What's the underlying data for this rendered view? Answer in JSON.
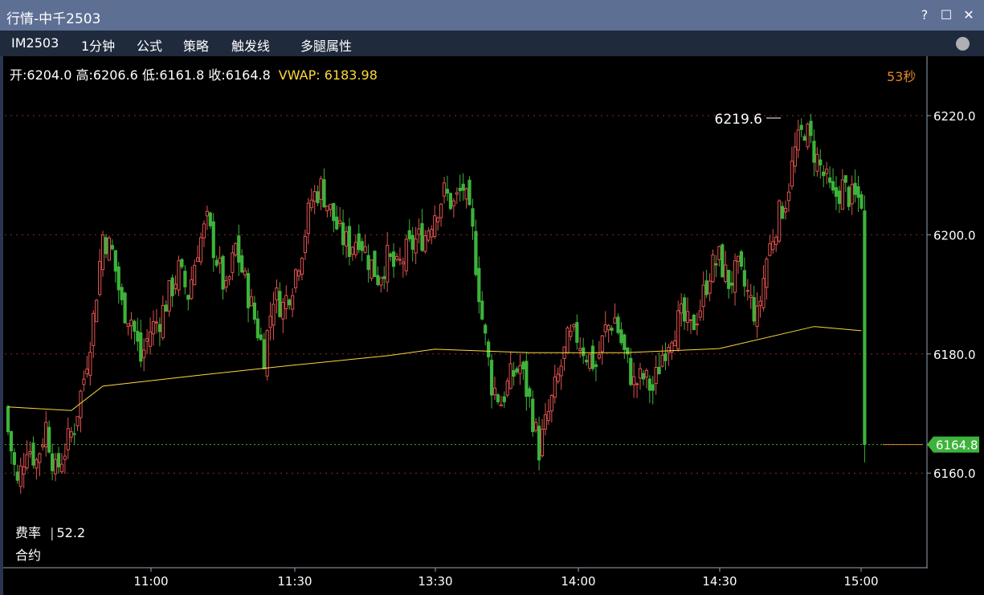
{
  "window": {
    "title": "行情-中千2503",
    "buttons": [
      "?",
      "☐",
      "✕"
    ]
  },
  "toolbar": {
    "items": [
      "IM2503",
      "1分钟",
      "公式",
      "策略",
      "触发线",
      "多腿属性"
    ]
  },
  "info": {
    "ohlc": "开:6204.0 高:6206.6 低:6161.8 收:6164.8",
    "vwap": "VWAP: 6183.98",
    "countdown": "53秒"
  },
  "side_panel": {
    "rate_label": "费率",
    "rate_value": "52.2",
    "contract_label": "合约"
  },
  "colors": {
    "up": "#e0524f",
    "down": "#3db33b",
    "vwap_line": "#ffd93b",
    "grid": "#8a2a2a",
    "last_price_line": "#3db33b",
    "titlebar": "#5d6f93"
  },
  "chart_data": {
    "type": "candlestick",
    "title": "",
    "ylim": [
      6145,
      6230
    ],
    "y_ticks": [
      "6220.0",
      "6200.0",
      "6180.0",
      "6160.0"
    ],
    "x_ticks": [
      "11:00",
      "11:30",
      "13:30",
      "14:00",
      "14:30",
      "15:00"
    ],
    "high_annotation": "6219.6",
    "last_price_label": "6164.8",
    "last_price": 6164.8,
    "vwap_anchors": [
      [
        0,
        6171.1
      ],
      [
        20,
        6170.5
      ],
      [
        30,
        6174.6
      ],
      [
        60,
        6176.4
      ],
      [
        90,
        6178.1
      ],
      [
        120,
        6179.7
      ],
      [
        135,
        6180.8
      ],
      [
        165,
        6180.2
      ],
      [
        195,
        6180.2
      ],
      [
        225,
        6180.9
      ],
      [
        255,
        6184.6
      ],
      [
        270,
        6183.9
      ]
    ],
    "path_anchors": [
      [
        0,
        6167
      ],
      [
        3,
        6158
      ],
      [
        6,
        6165
      ],
      [
        9,
        6162
      ],
      [
        12,
        6168
      ],
      [
        15,
        6160
      ],
      [
        18,
        6164
      ],
      [
        21,
        6168
      ],
      [
        24,
        6176
      ],
      [
        27,
        6186
      ],
      [
        30,
        6200
      ],
      [
        33,
        6197
      ],
      [
        36,
        6188
      ],
      [
        39,
        6186
      ],
      [
        42,
        6179
      ],
      [
        45,
        6184
      ],
      [
        48,
        6186
      ],
      [
        51,
        6190
      ],
      [
        54,
        6194
      ],
      [
        57,
        6190
      ],
      [
        60,
        6198
      ],
      [
        63,
        6202
      ],
      [
        66,
        6196
      ],
      [
        69,
        6190
      ],
      [
        72,
        6198
      ],
      [
        75,
        6192
      ],
      [
        78,
        6186
      ],
      [
        81,
        6180
      ],
      [
        84,
        6190
      ],
      [
        87,
        6188
      ],
      [
        90,
        6192
      ],
      [
        93,
        6198
      ],
      [
        96,
        6206
      ],
      [
        99,
        6208
      ],
      [
        102,
        6204
      ],
      [
        105,
        6200
      ],
      [
        108,
        6198
      ],
      [
        111,
        6200
      ],
      [
        114,
        6196
      ],
      [
        117,
        6193
      ],
      [
        120,
        6196
      ],
      [
        123,
        6194
      ],
      [
        126,
        6197
      ],
      [
        129,
        6199
      ],
      [
        132,
        6200
      ],
      [
        135,
        6204
      ],
      [
        138,
        6207
      ],
      [
        141,
        6205
      ],
      [
        144,
        6208
      ],
      [
        147,
        6200
      ],
      [
        150,
        6186
      ],
      [
        153,
        6175
      ],
      [
        156,
        6172
      ],
      [
        159,
        6176
      ],
      [
        162,
        6178
      ],
      [
        165,
        6172
      ],
      [
        168,
        6164
      ],
      [
        171,
        6170
      ],
      [
        174,
        6176
      ],
      [
        177,
        6182
      ],
      [
        180,
        6183
      ],
      [
        183,
        6180
      ],
      [
        186,
        6178
      ],
      [
        189,
        6184
      ],
      [
        192,
        6186
      ],
      [
        195,
        6180
      ],
      [
        198,
        6175
      ],
      [
        201,
        6176
      ],
      [
        204,
        6174
      ],
      [
        207,
        6180
      ],
      [
        210,
        6184
      ],
      [
        213,
        6186
      ],
      [
        216,
        6184
      ],
      [
        219,
        6188
      ],
      [
        222,
        6194
      ],
      [
        225,
        6196
      ],
      [
        228,
        6192
      ],
      [
        231,
        6194
      ],
      [
        234,
        6190
      ],
      [
        237,
        6186
      ],
      [
        240,
        6196
      ],
      [
        243,
        6202
      ],
      [
        246,
        6206
      ],
      [
        249,
        6214
      ],
      [
        252,
        6218
      ],
      [
        255,
        6214
      ],
      [
        258,
        6210
      ],
      [
        261,
        6206
      ],
      [
        264,
        6208
      ],
      [
        267,
        6206
      ],
      [
        270,
        6206
      ],
      [
        271,
        6164.8
      ]
    ]
  }
}
